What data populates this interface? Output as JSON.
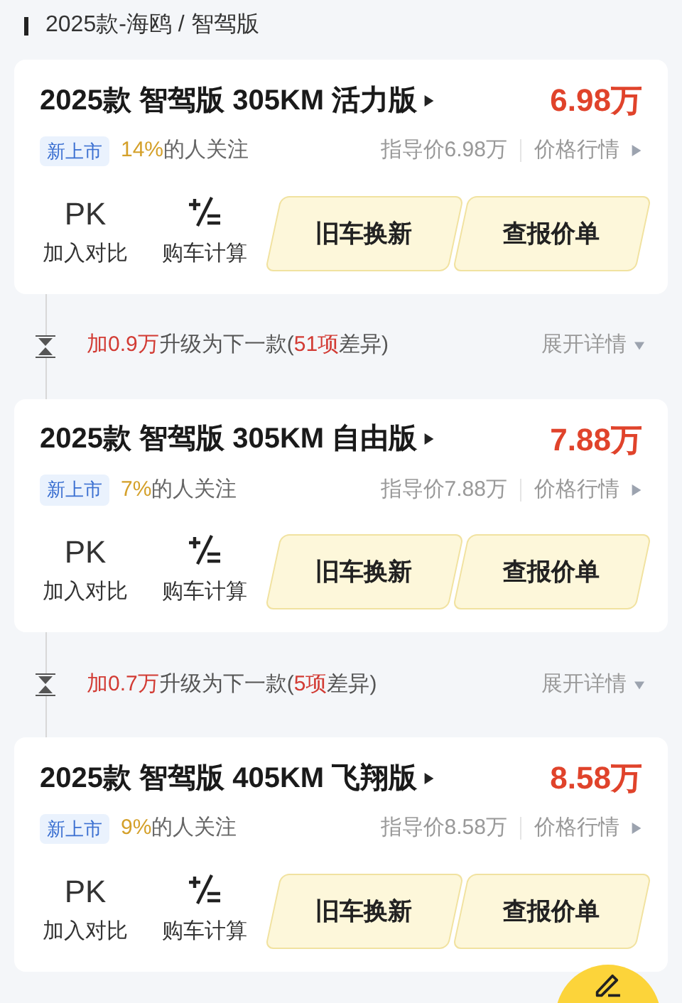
{
  "header": {
    "title": "2025款-海鸥 / 智驾版"
  },
  "trims": [
    {
      "name": "2025款 智驾版 305KM 活力版",
      "price": "6.98万",
      "tag": "新上市",
      "attention_percent": "14%",
      "attention_label": "的人关注",
      "guide_price": "指导价6.98万",
      "market_link": "价格行情",
      "compare_icon_text": "PK",
      "compare_label": "加入对比",
      "calc_label": "购车计算",
      "trade_in": "旧车换新",
      "quote": "查报价单",
      "upgrade": {
        "add": "加0.9万",
        "middle": "升级为下一款(",
        "count": "51项",
        "end": "差异)",
        "expand": "展开详情"
      }
    },
    {
      "name": "2025款 智驾版 305KM 自由版",
      "price": "7.88万",
      "tag": "新上市",
      "attention_percent": "7%",
      "attention_label": "的人关注",
      "guide_price": "指导价7.88万",
      "market_link": "价格行情",
      "compare_icon_text": "PK",
      "compare_label": "加入对比",
      "calc_label": "购车计算",
      "trade_in": "旧车换新",
      "quote": "查报价单",
      "upgrade": {
        "add": "加0.7万",
        "middle": "升级为下一款(",
        "count": "5项",
        "end": "差异)",
        "expand": "展开详情"
      }
    },
    {
      "name": "2025款 智驾版 405KM 飞翔版",
      "price": "8.58万",
      "tag": "新上市",
      "attention_percent": "9%",
      "attention_label": "的人关注",
      "guide_price": "指导价8.58万",
      "market_link": "价格行情",
      "compare_icon_text": "PK",
      "compare_label": "加入对比",
      "calc_label": "购车计算",
      "trade_in": "旧车换新",
      "quote": "查报价单"
    }
  ]
}
